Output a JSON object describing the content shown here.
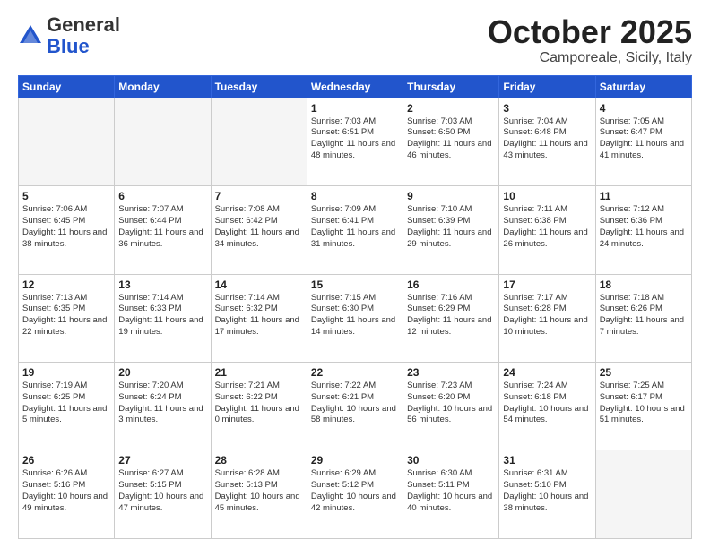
{
  "logo": {
    "general": "General",
    "blue": "Blue"
  },
  "header": {
    "title": "October 2025",
    "location": "Camporeale, Sicily, Italy"
  },
  "weekdays": [
    "Sunday",
    "Monday",
    "Tuesday",
    "Wednesday",
    "Thursday",
    "Friday",
    "Saturday"
  ],
  "weeks": [
    [
      {
        "day": "",
        "info": ""
      },
      {
        "day": "",
        "info": ""
      },
      {
        "day": "",
        "info": ""
      },
      {
        "day": "1",
        "info": "Sunrise: 7:03 AM\nSunset: 6:51 PM\nDaylight: 11 hours\nand 48 minutes."
      },
      {
        "day": "2",
        "info": "Sunrise: 7:03 AM\nSunset: 6:50 PM\nDaylight: 11 hours\nand 46 minutes."
      },
      {
        "day": "3",
        "info": "Sunrise: 7:04 AM\nSunset: 6:48 PM\nDaylight: 11 hours\nand 43 minutes."
      },
      {
        "day": "4",
        "info": "Sunrise: 7:05 AM\nSunset: 6:47 PM\nDaylight: 11 hours\nand 41 minutes."
      }
    ],
    [
      {
        "day": "5",
        "info": "Sunrise: 7:06 AM\nSunset: 6:45 PM\nDaylight: 11 hours\nand 38 minutes."
      },
      {
        "day": "6",
        "info": "Sunrise: 7:07 AM\nSunset: 6:44 PM\nDaylight: 11 hours\nand 36 minutes."
      },
      {
        "day": "7",
        "info": "Sunrise: 7:08 AM\nSunset: 6:42 PM\nDaylight: 11 hours\nand 34 minutes."
      },
      {
        "day": "8",
        "info": "Sunrise: 7:09 AM\nSunset: 6:41 PM\nDaylight: 11 hours\nand 31 minutes."
      },
      {
        "day": "9",
        "info": "Sunrise: 7:10 AM\nSunset: 6:39 PM\nDaylight: 11 hours\nand 29 minutes."
      },
      {
        "day": "10",
        "info": "Sunrise: 7:11 AM\nSunset: 6:38 PM\nDaylight: 11 hours\nand 26 minutes."
      },
      {
        "day": "11",
        "info": "Sunrise: 7:12 AM\nSunset: 6:36 PM\nDaylight: 11 hours\nand 24 minutes."
      }
    ],
    [
      {
        "day": "12",
        "info": "Sunrise: 7:13 AM\nSunset: 6:35 PM\nDaylight: 11 hours\nand 22 minutes."
      },
      {
        "day": "13",
        "info": "Sunrise: 7:14 AM\nSunset: 6:33 PM\nDaylight: 11 hours\nand 19 minutes."
      },
      {
        "day": "14",
        "info": "Sunrise: 7:14 AM\nSunset: 6:32 PM\nDaylight: 11 hours\nand 17 minutes."
      },
      {
        "day": "15",
        "info": "Sunrise: 7:15 AM\nSunset: 6:30 PM\nDaylight: 11 hours\nand 14 minutes."
      },
      {
        "day": "16",
        "info": "Sunrise: 7:16 AM\nSunset: 6:29 PM\nDaylight: 11 hours\nand 12 minutes."
      },
      {
        "day": "17",
        "info": "Sunrise: 7:17 AM\nSunset: 6:28 PM\nDaylight: 11 hours\nand 10 minutes."
      },
      {
        "day": "18",
        "info": "Sunrise: 7:18 AM\nSunset: 6:26 PM\nDaylight: 11 hours\nand 7 minutes."
      }
    ],
    [
      {
        "day": "19",
        "info": "Sunrise: 7:19 AM\nSunset: 6:25 PM\nDaylight: 11 hours\nand 5 minutes."
      },
      {
        "day": "20",
        "info": "Sunrise: 7:20 AM\nSunset: 6:24 PM\nDaylight: 11 hours\nand 3 minutes."
      },
      {
        "day": "21",
        "info": "Sunrise: 7:21 AM\nSunset: 6:22 PM\nDaylight: 11 hours\nand 0 minutes."
      },
      {
        "day": "22",
        "info": "Sunrise: 7:22 AM\nSunset: 6:21 PM\nDaylight: 10 hours\nand 58 minutes."
      },
      {
        "day": "23",
        "info": "Sunrise: 7:23 AM\nSunset: 6:20 PM\nDaylight: 10 hours\nand 56 minutes."
      },
      {
        "day": "24",
        "info": "Sunrise: 7:24 AM\nSunset: 6:18 PM\nDaylight: 10 hours\nand 54 minutes."
      },
      {
        "day": "25",
        "info": "Sunrise: 7:25 AM\nSunset: 6:17 PM\nDaylight: 10 hours\nand 51 minutes."
      }
    ],
    [
      {
        "day": "26",
        "info": "Sunrise: 6:26 AM\nSunset: 5:16 PM\nDaylight: 10 hours\nand 49 minutes."
      },
      {
        "day": "27",
        "info": "Sunrise: 6:27 AM\nSunset: 5:15 PM\nDaylight: 10 hours\nand 47 minutes."
      },
      {
        "day": "28",
        "info": "Sunrise: 6:28 AM\nSunset: 5:13 PM\nDaylight: 10 hours\nand 45 minutes."
      },
      {
        "day": "29",
        "info": "Sunrise: 6:29 AM\nSunset: 5:12 PM\nDaylight: 10 hours\nand 42 minutes."
      },
      {
        "day": "30",
        "info": "Sunrise: 6:30 AM\nSunset: 5:11 PM\nDaylight: 10 hours\nand 40 minutes."
      },
      {
        "day": "31",
        "info": "Sunrise: 6:31 AM\nSunset: 5:10 PM\nDaylight: 10 hours\nand 38 minutes."
      },
      {
        "day": "",
        "info": ""
      }
    ]
  ]
}
